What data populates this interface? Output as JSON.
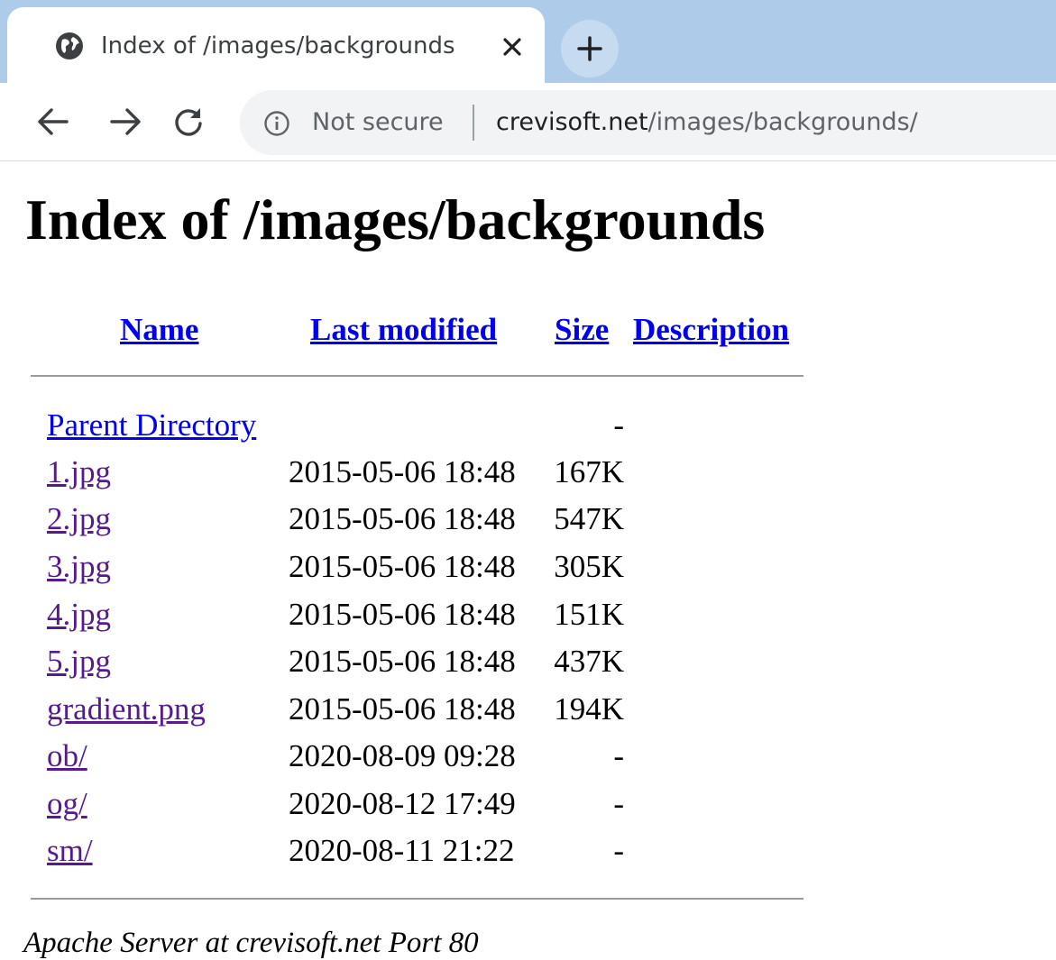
{
  "browser": {
    "tab": {
      "title": "Index of /images/backgrounds",
      "favicon": "globe-icon",
      "close": "close-icon"
    },
    "new_tab": "plus-icon",
    "toolbar": {
      "back": "arrow-left-icon",
      "forward": "arrow-right-icon",
      "reload": "reload-icon"
    },
    "omnibox": {
      "security_icon": "info-icon",
      "security_label": "Not secure",
      "url_domain": "crevisoft.net",
      "url_path": "/images/backgrounds/"
    },
    "colors": {
      "tabstrip": "#aecbe9",
      "omnibox": "#f1f3f4",
      "link": "#0000ee",
      "visited_link": "#551a8b"
    }
  },
  "page": {
    "title": "Index of /images/backgrounds",
    "columns": {
      "name": "Name",
      "last_modified": "Last modified",
      "size": "Size",
      "description": "Description"
    },
    "entries": [
      {
        "name": "Parent Directory",
        "modified": "",
        "size": "-",
        "visited": false
      },
      {
        "name": "1.jpg",
        "modified": "2015-05-06 18:48",
        "size": "167K",
        "visited": true
      },
      {
        "name": "2.jpg",
        "modified": "2015-05-06 18:48",
        "size": "547K",
        "visited": true
      },
      {
        "name": "3.jpg",
        "modified": "2015-05-06 18:48",
        "size": "305K",
        "visited": true
      },
      {
        "name": "4.jpg",
        "modified": "2015-05-06 18:48",
        "size": "151K",
        "visited": true
      },
      {
        "name": "5.jpg",
        "modified": "2015-05-06 18:48",
        "size": "437K",
        "visited": true
      },
      {
        "name": "gradient.png",
        "modified": "2015-05-06 18:48",
        "size": "194K",
        "visited": true
      },
      {
        "name": "ob/",
        "modified": "2020-08-09 09:28",
        "size": "-",
        "visited": true
      },
      {
        "name": "og/",
        "modified": "2020-08-12 17:49",
        "size": "-",
        "visited": true
      },
      {
        "name": "sm/",
        "modified": "2020-08-11 21:22",
        "size": "-",
        "visited": true
      }
    ],
    "footer": "Apache Server at crevisoft.net Port 80"
  }
}
